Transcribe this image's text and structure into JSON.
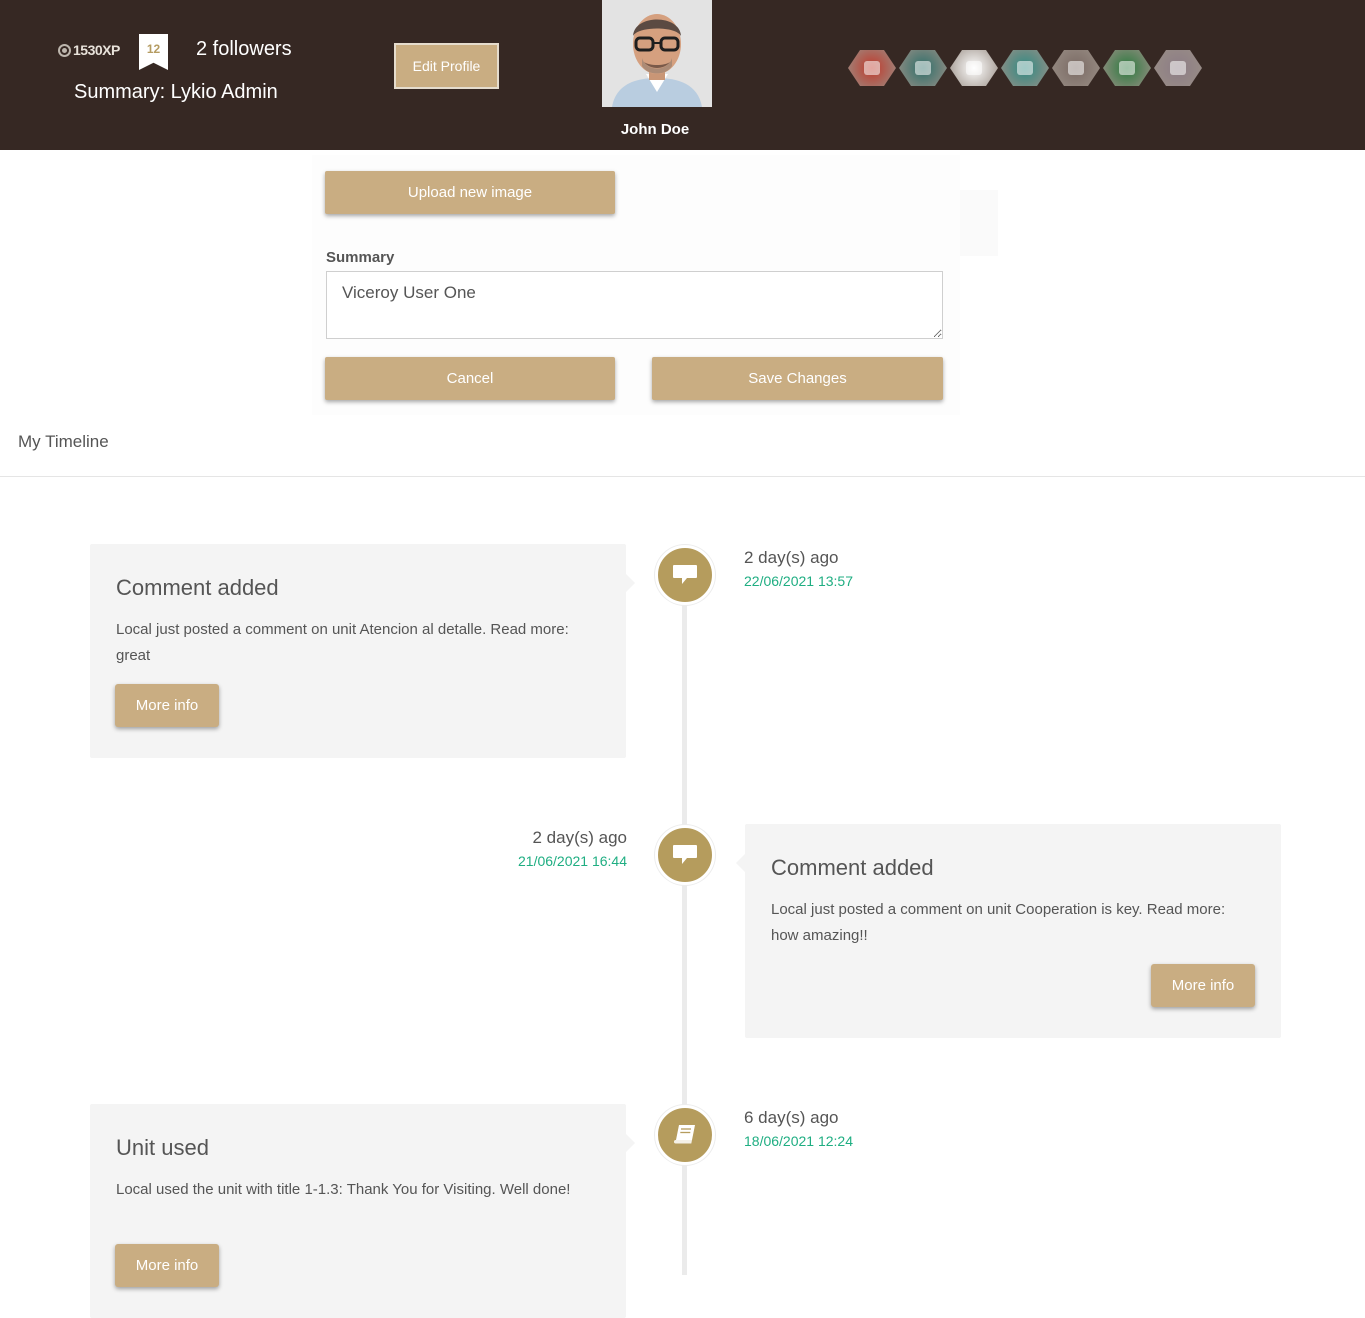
{
  "header": {
    "xp": "1530XP",
    "level": "12",
    "followers": "2 followers",
    "summary": "Summary: Lykio Admin",
    "edit_profile_label": "Edit Profile",
    "user_name": "John Doe",
    "colors": {
      "background": "#362823",
      "accent": "#c9ad82"
    },
    "badges": [
      {
        "name": "badge-1",
        "color": "#c0392b"
      },
      {
        "name": "badge-2",
        "color": "#2e6f6a"
      },
      {
        "name": "badge-3",
        "color": "#ffffff"
      },
      {
        "name": "badge-4",
        "color": "#2f8a83"
      },
      {
        "name": "badge-5",
        "color": "#7a6a64"
      },
      {
        "name": "badge-6",
        "color": "#2b7a3e"
      },
      {
        "name": "badge-7",
        "color": "#8c7c86"
      }
    ]
  },
  "form": {
    "upload_label": "Upload new image",
    "summary_label": "Summary",
    "summary_value": "Viceroy User One",
    "cancel_label": "Cancel",
    "save_label": "Save Changes"
  },
  "timeline": {
    "title": "My Timeline",
    "accent_color": "#b59c5d",
    "date_color": "#1fae82",
    "items": [
      {
        "title": "Comment added",
        "body": "Local just posted a comment on unit Atencion al detalle. Read more: great",
        "button": "More info",
        "ago": "2 day(s) ago",
        "date": "22/06/2021 13:57",
        "icon": "comment-icon"
      },
      {
        "title": "Comment added",
        "body": "Local just posted a comment on unit Cooperation is key. Read more: how amazing!!",
        "button": "More info",
        "ago": "2 day(s) ago",
        "date": "21/06/2021 16:44",
        "icon": "comment-icon"
      },
      {
        "title": "Unit used",
        "body": "Local used the unit with title 1-1.3: Thank You for Visiting. Well done!",
        "button": "More info",
        "ago": "6 day(s) ago",
        "date": "18/06/2021 12:24",
        "icon": "book-icon"
      }
    ]
  }
}
